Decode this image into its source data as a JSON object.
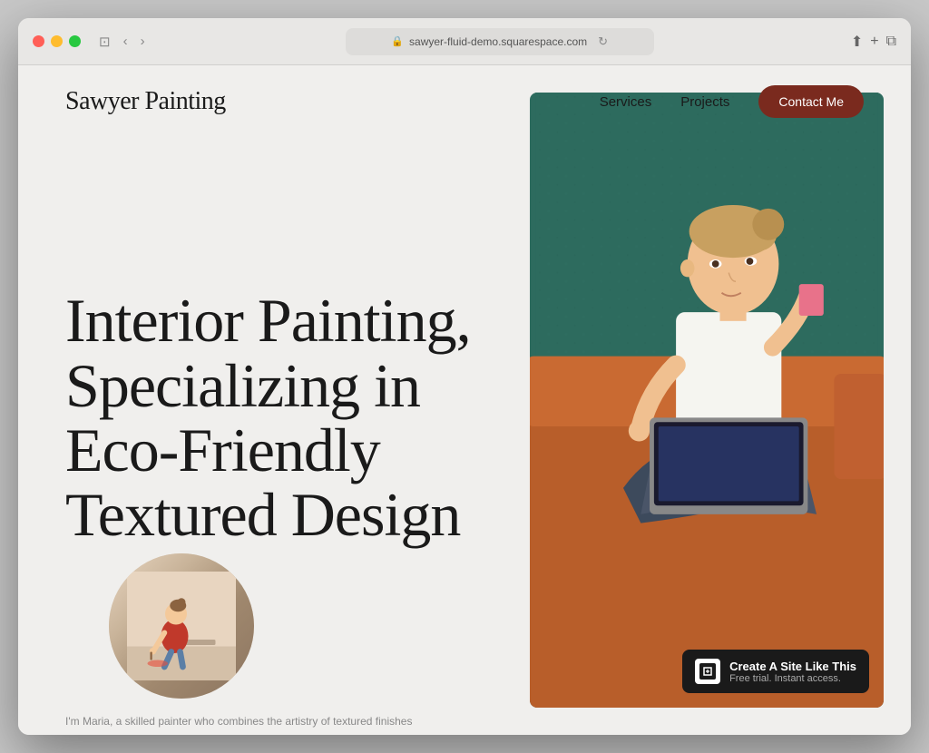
{
  "browser": {
    "url": "sawyer-fluid-demo.squarespace.com",
    "reload_symbol": "↻",
    "back_symbol": "‹",
    "forward_symbol": "›",
    "window_symbol": "⊡",
    "share_symbol": "⬆",
    "add_tab_symbol": "+",
    "duplicate_symbol": "⧉"
  },
  "nav": {
    "logo": "Sawyer Painting",
    "links": [
      {
        "label": "Services",
        "href": "#"
      },
      {
        "label": "Projects",
        "href": "#"
      }
    ],
    "cta": "Contact Me"
  },
  "hero": {
    "heading": "Interior Painting, Specializing in Eco-Friendly Textured Design",
    "caption": "I'm Maria, a skilled painter who combines the artistry of textured finishes"
  },
  "badge": {
    "title": "Create A Site Like This",
    "subtitle": "Free trial. Instant access."
  }
}
